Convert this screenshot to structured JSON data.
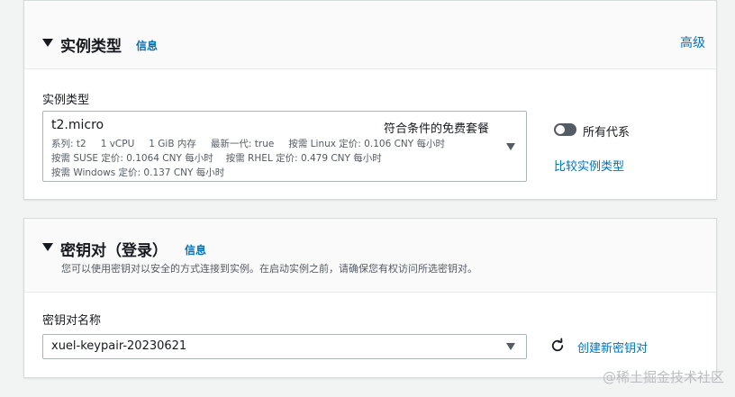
{
  "instance_type_section": {
    "title": "实例类型",
    "info_link": "信息",
    "advanced_link": "高级",
    "field_label": "实例类型",
    "selected": {
      "name": "t2.micro",
      "free_tier": "符合条件的免费套餐",
      "details_line1": [
        "系列: t2",
        "1 vCPU",
        "1 GiB 内存",
        "最新一代: true",
        "按需 Linux 定价: 0.106 CNY 每小时"
      ],
      "details_line2": [
        "按需 SUSE 定价: 0.1064 CNY 每小时",
        "按需 RHEL 定价: 0.479 CNY 每小时"
      ],
      "details_line3": "按需 Windows 定价: 0.137 CNY 每小时"
    },
    "toggle_label": "所有代系",
    "toggle_on": false,
    "compare_link": "比较实例类型"
  },
  "keypair_section": {
    "title": "密钥对（登录）",
    "info_link": "信息",
    "description": "您可以使用密钥对以安全的方式连接到实例。在启动实例之前，请确保您有权访问所选密钥对。",
    "field_label": "密钥对名称",
    "selected_value": "xuel-keypair-20230621",
    "create_link": "创建新密钥对"
  },
  "watermark": "@稀土掘金技术社区",
  "colors": {
    "link": "#0073bb",
    "text": "#16191f",
    "secondary_text": "#545b64",
    "page_background": "#f2f3f3"
  },
  "icons": {
    "section_caret": "caret-down-icon",
    "dropdown": "dropdown-arrow-icon",
    "refresh": "refresh-icon"
  }
}
